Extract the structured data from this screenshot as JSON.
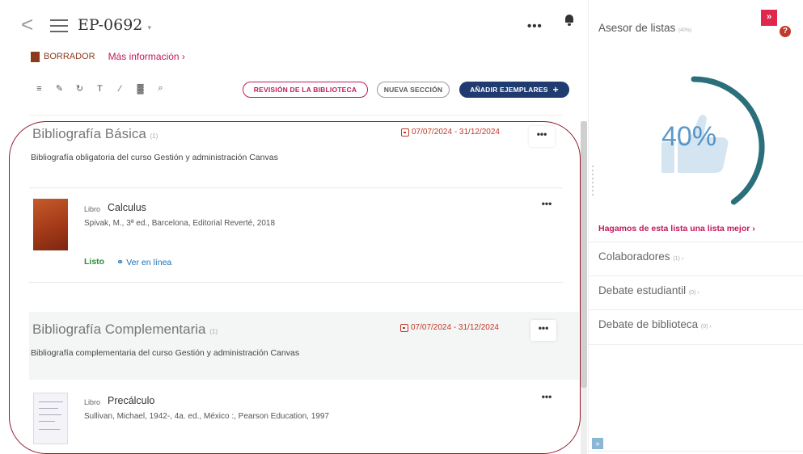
{
  "header": {
    "back_glyph": "<",
    "title": "EP-0692",
    "title_suffix": "▾",
    "more_glyph": "•••"
  },
  "status": {
    "draft_label": "BORRADOR",
    "more_info_label": "Más información ›"
  },
  "toolbar": {
    "icons": [
      {
        "name": "list-icon",
        "glyph": "≡"
      },
      {
        "name": "edit-icon",
        "glyph": "✎"
      },
      {
        "name": "refresh-icon",
        "glyph": "↻"
      },
      {
        "name": "text-icon",
        "glyph": "T"
      },
      {
        "name": "pen-icon",
        "glyph": "∕"
      },
      {
        "name": "chart-icon",
        "glyph": "▓"
      },
      {
        "name": "search-icon",
        "glyph": "⌕"
      }
    ],
    "library_review_label": "REVISIÓN DE LA BIBLIOTECA",
    "new_section_label": "NUEVA SECCIÓN",
    "add_items_label": "AÑADIR EJEMPLARES",
    "add_plus": "+"
  },
  "sections": [
    {
      "title": "Bibliografía Básica",
      "count": "(1)",
      "date": "07/07/2024 - 31/12/2024",
      "description": "Bibliografía obligatoria del curso Gestión y administración Canvas",
      "item": {
        "kind": "Libro",
        "title": "Calculus",
        "meta": "Spivak, M., 3ª ed., Barcelona, Editorial Reverté, 2018",
        "status": "Listo",
        "online_label": "Ver en línea"
      }
    },
    {
      "title": "Bibliografía Complementaria",
      "count": "(1)",
      "date": "07/07/2024 - 31/12/2024",
      "description": "Bibliografía complementaria del curso Gestión y administración Canvas",
      "item": {
        "kind": "Libro",
        "title": "Precálculo",
        "meta": "Sullivan, Michael, 1942-, 4a. ed., México :, Pearson Education, 1997"
      }
    }
  ],
  "dots_glyph": "•••",
  "sidebar": {
    "title": "Asesor de listas",
    "title_badge": "(40%)",
    "badge_glyph": "»",
    "help_glyph": "?",
    "progress_percent": 40,
    "progress_label": "40%",
    "improve_link": "Hagamos de esta lista una lista mejor ›",
    "rows": [
      {
        "label": "Colaboradores",
        "count": "(1) ›"
      },
      {
        "label": "Debate estudiantil",
        "count": "(0) ›"
      },
      {
        "label": "Debate de biblioteca",
        "count": "(0) ›"
      }
    ],
    "expand_glyph": "»"
  },
  "colors": {
    "accent": "#c2185b",
    "primary_button": "#1f3b6f",
    "gauge": "#2a6f7a",
    "date": "#c0392b",
    "ready": "#2e8b3a"
  }
}
